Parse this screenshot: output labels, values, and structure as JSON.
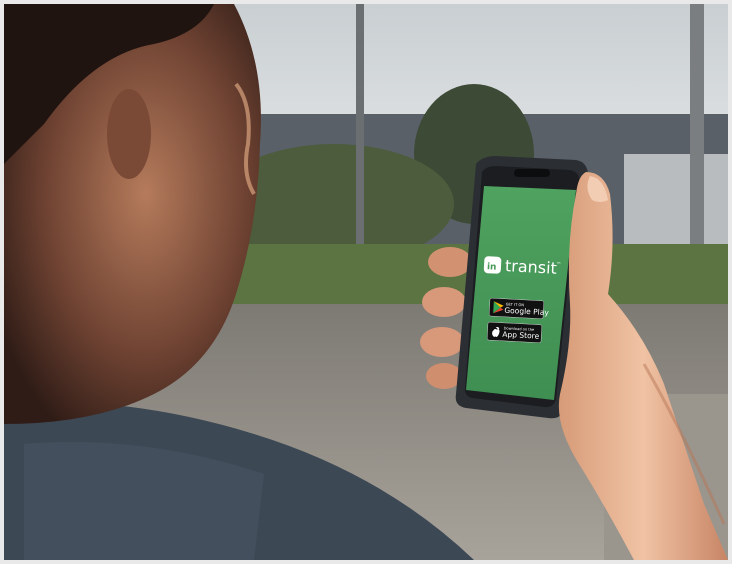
{
  "photo": {
    "subject": "person holding smartphone outdoors",
    "phone_screen": {
      "brand_mark": "transit",
      "brand_trademark": "™",
      "badge_google_top": "GET IT ON",
      "badge_google_main": "Google Play",
      "badge_apple_top": "Download on the",
      "badge_apple_main": "App Store",
      "screen_color": "#4a9a5a"
    },
    "colors": {
      "sky": "#cfd3d4",
      "foliage": "#4b5a3a",
      "road": "#8f8c86",
      "skin_light": "#e8b48f",
      "skin_shadow": "#4a2c22",
      "shirt": "#3f4a57"
    }
  }
}
